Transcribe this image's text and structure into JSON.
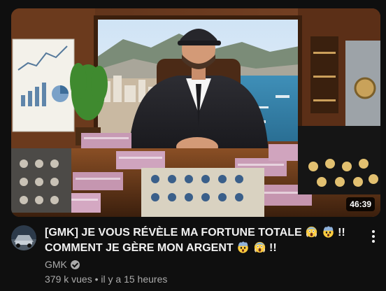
{
  "video": {
    "title_line1": "[GMK] JE VOUS RÉVÈLE MA FORTUNE TOTALE",
    "title_line1_suffix": "!!",
    "title_line2": "COMMENT JE GÈRE MON ARGENT",
    "title_line2_suffix": "!!",
    "duration": "46:39",
    "channel": "GMK",
    "views": "379 k vues",
    "separator": "•",
    "age": "il y a 15 heures"
  },
  "icons": {
    "verified": "verified-check-icon",
    "more": "more-vert-icon",
    "emoji1": "face-screaming-in-fear",
    "emoji2": "exploding-head",
    "emoji3": "exploding-head",
    "emoji4": "face-screaming-in-fear"
  },
  "colors": {
    "background": "#0f0f0f",
    "primary_text": "#f1f1f1",
    "secondary_text": "#aaaaaa"
  }
}
